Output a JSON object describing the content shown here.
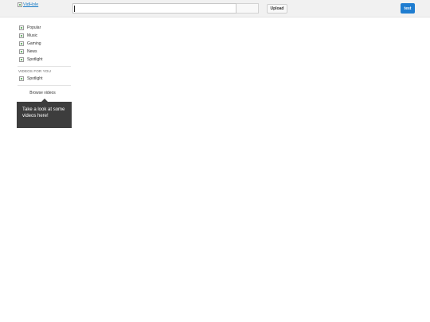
{
  "header": {
    "logo_alt": "VidHole",
    "upload_label": "Upload",
    "user_label": "test"
  },
  "sidebar": {
    "items": [
      {
        "label": "Popular"
      },
      {
        "label": "Music"
      },
      {
        "label": "Gaming"
      },
      {
        "label": "News"
      },
      {
        "label": "Spotlight"
      }
    ],
    "section_title": "VIDEOS FOR YOU",
    "personal_items": [
      {
        "label": "Spotlight"
      }
    ],
    "browse_label": "Browse videos"
  },
  "tooltip": {
    "text": "Take a look at some videos here!"
  }
}
